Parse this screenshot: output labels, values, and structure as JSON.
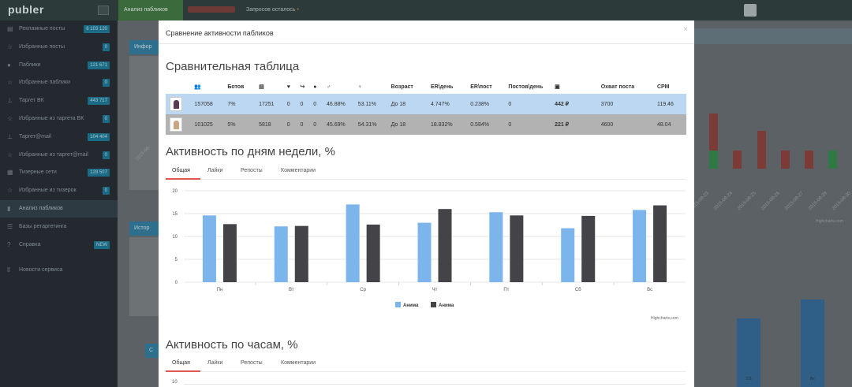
{
  "topbar": {
    "brand": "publer",
    "nav_active": "Анализ пабликов",
    "nav_requests": "Запросов осталось",
    "nav_requests_dot": "•"
  },
  "sidebar": {
    "items": [
      {
        "icon": "newspaper-icon",
        "glyph": "▤",
        "label": "Рекламные посты",
        "badge": "6 103 120"
      },
      {
        "icon": "star-icon",
        "glyph": "☆",
        "label": "Избранные посты",
        "badge": "0"
      },
      {
        "icon": "comments-icon",
        "glyph": "●",
        "label": "Паблики",
        "badge": "121 671"
      },
      {
        "icon": "star-icon",
        "glyph": "☆",
        "label": "Избранные паблики",
        "badge": "0"
      },
      {
        "icon": "target-icon",
        "glyph": "⊥",
        "label": "Таргет ВК",
        "badge": "443 717"
      },
      {
        "icon": "star-icon",
        "glyph": "☆",
        "label": "Избранные из таргета ВК",
        "badge": "0"
      },
      {
        "icon": "target-icon",
        "glyph": "⊥",
        "label": "Таргет@mail",
        "badge": "104 404"
      },
      {
        "icon": "star-icon",
        "glyph": "☆",
        "label": "Избранные из таргет@mail",
        "badge": "0"
      },
      {
        "icon": "grid-icon",
        "glyph": "▦",
        "label": "Тизерные сети",
        "badge": "128 507"
      },
      {
        "icon": "star-icon",
        "glyph": "☆",
        "label": "Избранные из тизерок",
        "badge": "0"
      },
      {
        "icon": "chart-icon",
        "glyph": "▮",
        "label": "Анализ пабликов",
        "badge": ""
      },
      {
        "icon": "database-icon",
        "glyph": "☰",
        "label": "Базы ретаргетинга",
        "badge": ""
      },
      {
        "icon": "question-icon",
        "glyph": "?",
        "label": "Справка",
        "badge": "NEW"
      },
      {
        "icon": "vk-icon",
        "glyph": "ʬ",
        "label": "Новости сервиса",
        "badge": ""
      }
    ]
  },
  "background": {
    "dates": [
      "2015-08-23",
      "2015-08-24",
      "2015-08-25",
      "2015-08-26",
      "2015-08-27",
      "2015-08-28",
      "2015-08-30"
    ],
    "credit": "Highcharts.com",
    "left_date": "2015-08-",
    "panel_labels": [
      "Инфор",
      "Истор",
      "С"
    ],
    "bottom_labels": [
      "Сб",
      "Вс"
    ]
  },
  "modal": {
    "title": "Сравнение активности пабликов",
    "close": "×",
    "table_title": "Сравнительная таблица",
    "table": {
      "headers": [
        {
          "key": "avatar",
          "label": "",
          "icon": ""
        },
        {
          "key": "members",
          "label": "",
          "icon": "users-icon",
          "glyph": "👥"
        },
        {
          "key": "bots",
          "label": "Ботов",
          "icon": ""
        },
        {
          "key": "posts",
          "label": "",
          "icon": "list-icon",
          "glyph": "▤"
        },
        {
          "key": "likes",
          "label": "",
          "icon": "heart-icon",
          "glyph": "♥"
        },
        {
          "key": "reposts",
          "label": "",
          "icon": "share-icon",
          "glyph": "↪"
        },
        {
          "key": "comments",
          "label": "",
          "icon": "comment-icon",
          "glyph": "●"
        },
        {
          "key": "male",
          "label": "",
          "icon": "male-icon",
          "glyph": "♂"
        },
        {
          "key": "female",
          "label": "",
          "icon": "female-icon",
          "glyph": "♀"
        },
        {
          "key": "age",
          "label": "Возраст"
        },
        {
          "key": "er_day",
          "label": "ER\\день"
        },
        {
          "key": "er_post",
          "label": "ER\\пост"
        },
        {
          "key": "posts_day",
          "label": "Постов\\день"
        },
        {
          "key": "price",
          "label": "",
          "icon": "money-icon",
          "glyph": "▣"
        },
        {
          "key": "reach",
          "label": "Охват поста"
        },
        {
          "key": "cpm",
          "label": "CPM"
        }
      ],
      "rows": [
        {
          "members": "157058",
          "bots": "7%",
          "posts": "17251",
          "likes": "0",
          "reposts": "0",
          "comments": "0",
          "male": "46.88%",
          "female": "53.11%",
          "age": "До 18",
          "er_day": "4.747%",
          "er_post": "0.238%",
          "posts_day": "0",
          "price": "442 ₽",
          "reach": "3700",
          "cpm": "119.46"
        },
        {
          "members": "101025",
          "bots": "5%",
          "posts": "5818",
          "likes": "0",
          "reposts": "0",
          "comments": "0",
          "male": "45.69%",
          "female": "54.31%",
          "age": "До 18",
          "er_day": "18.832%",
          "er_post": "0.584%",
          "posts_day": "0",
          "price": "221 ₽",
          "reach": "4600",
          "cpm": "48.04"
        }
      ]
    },
    "weekday_title": "Активность по дням недели, %",
    "hours_title": "Активность по часам, %",
    "tabs": [
      "Общая",
      "Лайки",
      "Репосты",
      "Комментарии"
    ],
    "credit": "Highcharts.com",
    "hours_axis_top": "10"
  },
  "colors": {
    "series1": "#7cb5ec",
    "series2": "#434348",
    "row1": "#bcd7f1",
    "row2": "#b2b2b2",
    "tab_accent": "#e0574f"
  },
  "chart_data": {
    "type": "bar",
    "title": "Активность по дням недели, %",
    "categories": [
      "Пн",
      "Вт",
      "Ср",
      "Чт",
      "Пт",
      "Сб",
      "Вс"
    ],
    "ylim": [
      0,
      20
    ],
    "yticks": [
      0,
      5,
      10,
      15,
      20
    ],
    "legend_position": "bottom-center",
    "grid": true,
    "series": [
      {
        "name": "Анима",
        "color": "#7cb5ec",
        "values": [
          14.6,
          12.2,
          17.0,
          13.0,
          15.3,
          11.8,
          15.8
        ]
      },
      {
        "name": "Анима",
        "color": "#434348",
        "values": [
          12.7,
          12.3,
          12.6,
          16.0,
          14.6,
          14.5,
          16.8
        ]
      }
    ]
  }
}
